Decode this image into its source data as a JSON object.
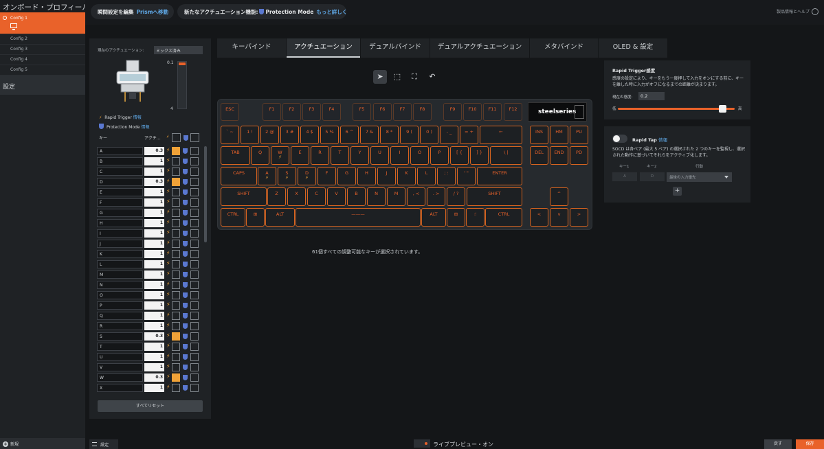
{
  "sidebar": {
    "title": "オンボード・プロフィール",
    "configs": [
      "Config 1",
      "Config 2",
      "Config 3",
      "Config 4",
      "Config 5"
    ],
    "settings_label": "設定",
    "new_label": "新規"
  },
  "topbar": {
    "pill1_text": "瞬間設定を編集",
    "pill1_link": "Prismへ移動",
    "pill2_text": "新たなアクチュエーション機能:",
    "pill2_feature": "Protection Mode",
    "pill2_link": "もっと詳しく",
    "help_label": "製品情報とヘルプ"
  },
  "left_panel": {
    "current_actuation_label": "現在のアクチュエーション:",
    "current_actuation_value": "ミックス済み",
    "slider_top_label": "0.1",
    "slider_bottom_label": "4",
    "rapid_trigger_label": "Rapid Trigger",
    "protection_mode_label": "Protection Mode",
    "info_label": "情報",
    "col_key": "キー",
    "col_actuation": "アクチ…",
    "reset_label": "すべてリセット",
    "key_rows": [
      {
        "key": "A",
        "value": "0.3",
        "checked": true
      },
      {
        "key": "B",
        "value": "1",
        "checked": false
      },
      {
        "key": "C",
        "value": "1",
        "checked": false
      },
      {
        "key": "D",
        "value": "0.3",
        "checked": true
      },
      {
        "key": "E",
        "value": "1",
        "checked": false
      },
      {
        "key": "F",
        "value": "1",
        "checked": false
      },
      {
        "key": "G",
        "value": "1",
        "checked": false
      },
      {
        "key": "H",
        "value": "1",
        "checked": false
      },
      {
        "key": "I",
        "value": "1",
        "checked": false
      },
      {
        "key": "J",
        "value": "1",
        "checked": false
      },
      {
        "key": "K",
        "value": "1",
        "checked": false
      },
      {
        "key": "L",
        "value": "1",
        "checked": false
      },
      {
        "key": "M",
        "value": "1",
        "checked": false
      },
      {
        "key": "N",
        "value": "1",
        "checked": false
      },
      {
        "key": "O",
        "value": "1",
        "checked": false
      },
      {
        "key": "P",
        "value": "1",
        "checked": false
      },
      {
        "key": "Q",
        "value": "1",
        "checked": false
      },
      {
        "key": "R",
        "value": "1",
        "checked": false
      },
      {
        "key": "S",
        "value": "0.3",
        "checked": true
      },
      {
        "key": "T",
        "value": "1",
        "checked": false
      },
      {
        "key": "U",
        "value": "1",
        "checked": false
      },
      {
        "key": "V",
        "value": "1",
        "checked": false
      },
      {
        "key": "W",
        "value": "0.3",
        "checked": true
      },
      {
        "key": "X",
        "value": "1",
        "checked": false
      }
    ]
  },
  "tabs": [
    "キーバインド",
    "アクチュエーション",
    "デュアルバインド",
    "デュアルアクチュエーション",
    "メタバインド",
    "OLED & 設定"
  ],
  "active_tab": "アクチュエーション",
  "tools": [
    "select-pointer-icon",
    "select-box-icon",
    "select-all-icon",
    "undo-icon"
  ],
  "keyboard": {
    "brand_label": "steelseries",
    "status_text": "61個すべての調整可能なキーが選択されています。",
    "keys": [
      {
        "label": "ESC"
      },
      {
        "label": "F1"
      },
      {
        "label": "F2"
      },
      {
        "label": "F3"
      },
      {
        "label": "F4"
      },
      {
        "label": "F5"
      },
      {
        "label": "F6"
      },
      {
        "label": "F7"
      },
      {
        "label": "F8"
      },
      {
        "label": "F9"
      },
      {
        "label": "F10"
      },
      {
        "label": "F11"
      },
      {
        "label": "F12"
      },
      {
        "label": "` ~"
      },
      {
        "label": "1 !"
      },
      {
        "label": "2 @"
      },
      {
        "label": "3 #"
      },
      {
        "label": "4 $"
      },
      {
        "label": "5 %"
      },
      {
        "label": "6 ^"
      },
      {
        "label": "7 &"
      },
      {
        "label": "8 *"
      },
      {
        "label": "9 ("
      },
      {
        "label": "0 )"
      },
      {
        "label": "- _"
      },
      {
        "label": "= +"
      },
      {
        "label": "←"
      },
      {
        "label": "INS"
      },
      {
        "label": "HM"
      },
      {
        "label": "PU"
      },
      {
        "label": "TAB"
      },
      {
        "label": "Q"
      },
      {
        "label": "W",
        "bolt": true
      },
      {
        "label": "E"
      },
      {
        "label": "R"
      },
      {
        "label": "T"
      },
      {
        "label": "Y"
      },
      {
        "label": "U"
      },
      {
        "label": "I"
      },
      {
        "label": "O"
      },
      {
        "label": "P"
      },
      {
        "label": "[ {"
      },
      {
        "label": "] }"
      },
      {
        "label": "\\ |"
      },
      {
        "label": "DEL"
      },
      {
        "label": "END"
      },
      {
        "label": "PD"
      },
      {
        "label": "CAPS"
      },
      {
        "label": "A",
        "bolt": true
      },
      {
        "label": "S",
        "bolt": true
      },
      {
        "label": "D",
        "bolt": true
      },
      {
        "label": "F"
      },
      {
        "label": "G"
      },
      {
        "label": "H"
      },
      {
        "label": "J"
      },
      {
        "label": "K"
      },
      {
        "label": "L"
      },
      {
        "label": "; :"
      },
      {
        "label": "' \""
      },
      {
        "label": "ENTER"
      },
      {
        "label": "SHIFT"
      },
      {
        "label": "Z"
      },
      {
        "label": "X"
      },
      {
        "label": "C"
      },
      {
        "label": "V"
      },
      {
        "label": "B"
      },
      {
        "label": "N"
      },
      {
        "label": "M"
      },
      {
        "label": ", <"
      },
      {
        "label": ". >"
      },
      {
        "label": "/ ?"
      },
      {
        "label": "SHIFT"
      },
      {
        "label": "^"
      },
      {
        "label": "CTRL"
      },
      {
        "label": "⊞"
      },
      {
        "label": "ALT"
      },
      {
        "label": "———"
      },
      {
        "label": "ALT"
      },
      {
        "label": "⊞"
      },
      {
        "label": "☝"
      },
      {
        "label": "CTRL"
      },
      {
        "label": "<"
      },
      {
        "label": "v"
      },
      {
        "label": ">"
      }
    ]
  },
  "rapid_trigger_panel": {
    "title": "Rapid Trigger感度",
    "description": "感度の設定により、キーをもう一度押して入力をオンにする前に、キーを離した時に入力がオフになるまでの距離が決まります。",
    "current_label": "現在の感度:",
    "current_value": "0.2",
    "slider_value": 0.9,
    "low_label": "低",
    "high_label": "高"
  },
  "rapid_tap_panel": {
    "title": "Rapid Tap",
    "info_label": "情報",
    "description": "SOCD は各ペア (最大 5 ペア) の選択された 2 つのキーを監視し、選択された動作に基づいてそれらをアクティブ化します。",
    "col_key1": "キー1",
    "col_key2": "キー2",
    "col_action": "行動",
    "key1_value": "A",
    "key2_value": "D",
    "action_placeholder": "最後の入力優先",
    "add_label": "+"
  },
  "bottombar": {
    "settings_label": "設定",
    "live_preview_label": "ライブプレビュー・オン",
    "back_label": "戻す",
    "save_label": "保存"
  },
  "colors": {
    "accent": "#e9622a",
    "bolt": "#f0a238",
    "shield": "#5a78d0",
    "link": "#5fa8e6"
  }
}
